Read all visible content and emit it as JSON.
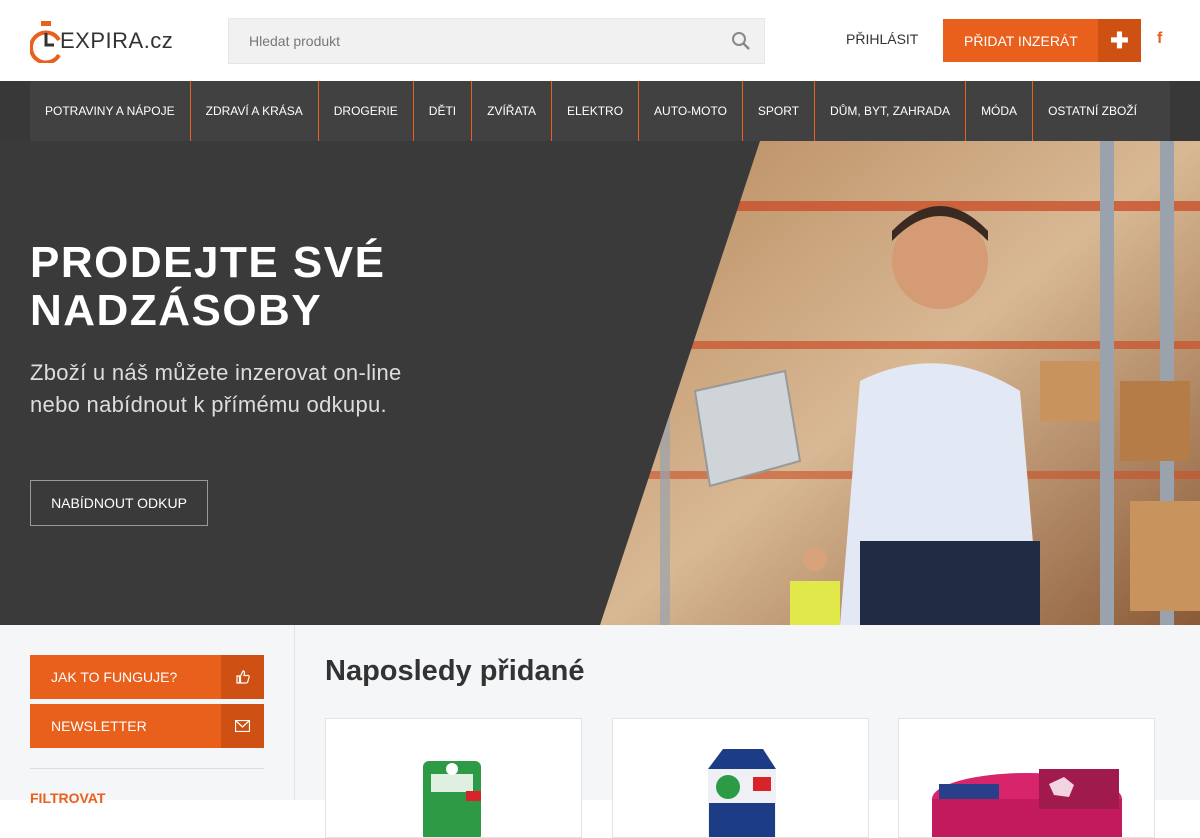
{
  "header": {
    "logo_text": "EXPIRA.cz",
    "search_placeholder": "Hledat produkt",
    "login_label": "PŘIHLÁSIT",
    "add_listing_label": "PŘIDAT INZERÁT",
    "facebook_label": "f"
  },
  "nav": {
    "items": [
      {
        "label": "POTRAVINY A NÁPOJE"
      },
      {
        "label": "ZDRAVÍ A KRÁSA"
      },
      {
        "label": "DROGERIE"
      },
      {
        "label": "DĚTI"
      },
      {
        "label": "ZVÍŘATA"
      },
      {
        "label": "ELEKTRO"
      },
      {
        "label": "AUTO-MOTO"
      },
      {
        "label": "SPORT"
      },
      {
        "label": "DŮM, BYT, ZAHRADA"
      },
      {
        "label": "MÓDA"
      },
      {
        "label": "OSTATNÍ ZBOŽÍ"
      }
    ]
  },
  "hero": {
    "title": "PRODEJTE SVÉ NADZÁSOBY",
    "subtitle": "Zboží u náš můžete inzerovat on-line nebo nabídnout k přímému odkupu.",
    "button_label": "NABÍDNOUT ODKUP"
  },
  "sidebar": {
    "how_it_works_label": "JAK TO FUNGUJE?",
    "newsletter_label": "NEWSLETTER",
    "filter_label": "FILTROVAT"
  },
  "main": {
    "section_title": "Naposledy přidané"
  },
  "colors": {
    "accent": "#e8601c",
    "accent_dark": "#cf5013",
    "dark": "#3a3a3a",
    "nav_bg": "#414141"
  }
}
